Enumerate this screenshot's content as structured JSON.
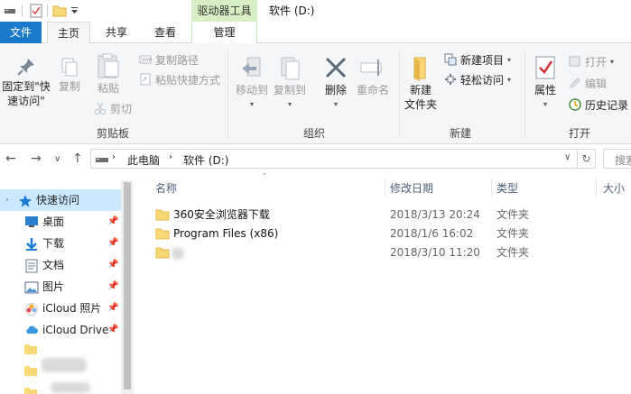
{
  "titlebar": {
    "context_tab_header": "驱动器工具",
    "window_title": "软件 (D:)"
  },
  "tabs": {
    "file": "文件",
    "home": "主页",
    "share": "共享",
    "view": "查看",
    "manage": "管理"
  },
  "ribbon": {
    "clipboard": {
      "pin_to_quick_access": "固定到\"快",
      "pin_to_quick_access_2": "速访问\"",
      "copy": "复制",
      "paste": "粘贴",
      "copy_path": "复制路径",
      "paste_shortcut": "粘贴快捷方式",
      "cut": "剪切",
      "group_label": "剪贴板"
    },
    "organize": {
      "move_to": "移动到",
      "copy_to": "复制到",
      "delete": "删除",
      "rename": "重命名",
      "group_label": "组织"
    },
    "new": {
      "new_folder": "新建",
      "new_folder_2": "文件夹",
      "new_item": "新建项目",
      "easy_access": "轻松访问",
      "group_label": "新建"
    },
    "open": {
      "properties": "属性",
      "open": "打开",
      "edit": "编辑",
      "history": "历史记录",
      "group_label": "打开"
    }
  },
  "address": {
    "this_pc": "此电脑",
    "drive": "软件 (D:)",
    "search_placeholder": "搜索"
  },
  "navpane": {
    "items": [
      {
        "label": "快速访问",
        "icon": "star-icon"
      },
      {
        "label": "桌面",
        "icon": "desktop-icon"
      },
      {
        "label": "下载",
        "icon": "download-icon"
      },
      {
        "label": "文档",
        "icon": "document-icon"
      },
      {
        "label": "图片",
        "icon": "picture-icon"
      },
      {
        "label": "iCloud 照片",
        "icon": "icloud-photos-icon"
      },
      {
        "label": "iCloud Drive",
        "icon": "icloud-drive-icon"
      }
    ]
  },
  "filelist": {
    "columns": {
      "name": "名称",
      "modified": "修改日期",
      "type": "类型",
      "size": "大小"
    },
    "rows": [
      {
        "name": "360安全浏览器下载",
        "modified": "2018/3/13 20:24",
        "type": "文件夹"
      },
      {
        "name": "Program Files (x86)",
        "modified": "2018/1/6 16:02",
        "type": "文件夹"
      },
      {
        "name": "",
        "modified": "2018/3/10 11:20",
        "type": "文件夹"
      }
    ]
  },
  "colors": {
    "file_tab": "#1979ca",
    "context_tab": "#d6efc4",
    "folder": "#f8d775",
    "selection": "#cce8ff"
  }
}
